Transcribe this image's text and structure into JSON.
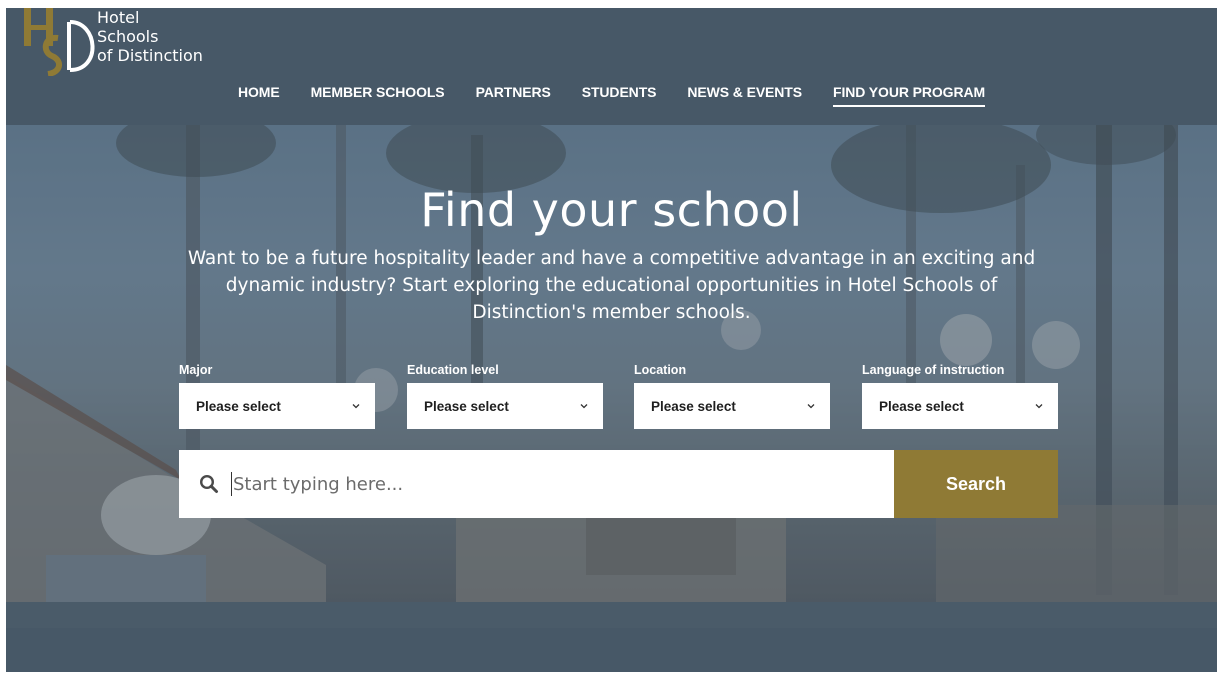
{
  "brand": {
    "logo_lines": [
      "Hotel",
      "Schools",
      "of Distinction"
    ],
    "gold": "#8f7a35",
    "navy": "#475867"
  },
  "nav": {
    "items": [
      {
        "label": "HOME"
      },
      {
        "label": "MEMBER SCHOOLS"
      },
      {
        "label": "PARTNERS"
      },
      {
        "label": "STUDENTS"
      },
      {
        "label": "NEWS & EVENTS"
      },
      {
        "label": "FIND YOUR PROGRAM",
        "active": true
      }
    ]
  },
  "hero": {
    "title": "Find your school",
    "subtitle": "Want to be a future hospitality leader and have a competitive advantage in an exciting and dynamic industry? Start exploring the educational opportunities in Hotel Schools of Distinction's member schools."
  },
  "filters": [
    {
      "label": "Major",
      "value": "Please select"
    },
    {
      "label": "Education level",
      "value": "Please select"
    },
    {
      "label": "Location",
      "value": "Please select"
    },
    {
      "label": "Language of instruction",
      "value": "Please select"
    }
  ],
  "search": {
    "placeholder": "Start typing here...",
    "button_label": "Search",
    "icon": "search-icon"
  }
}
